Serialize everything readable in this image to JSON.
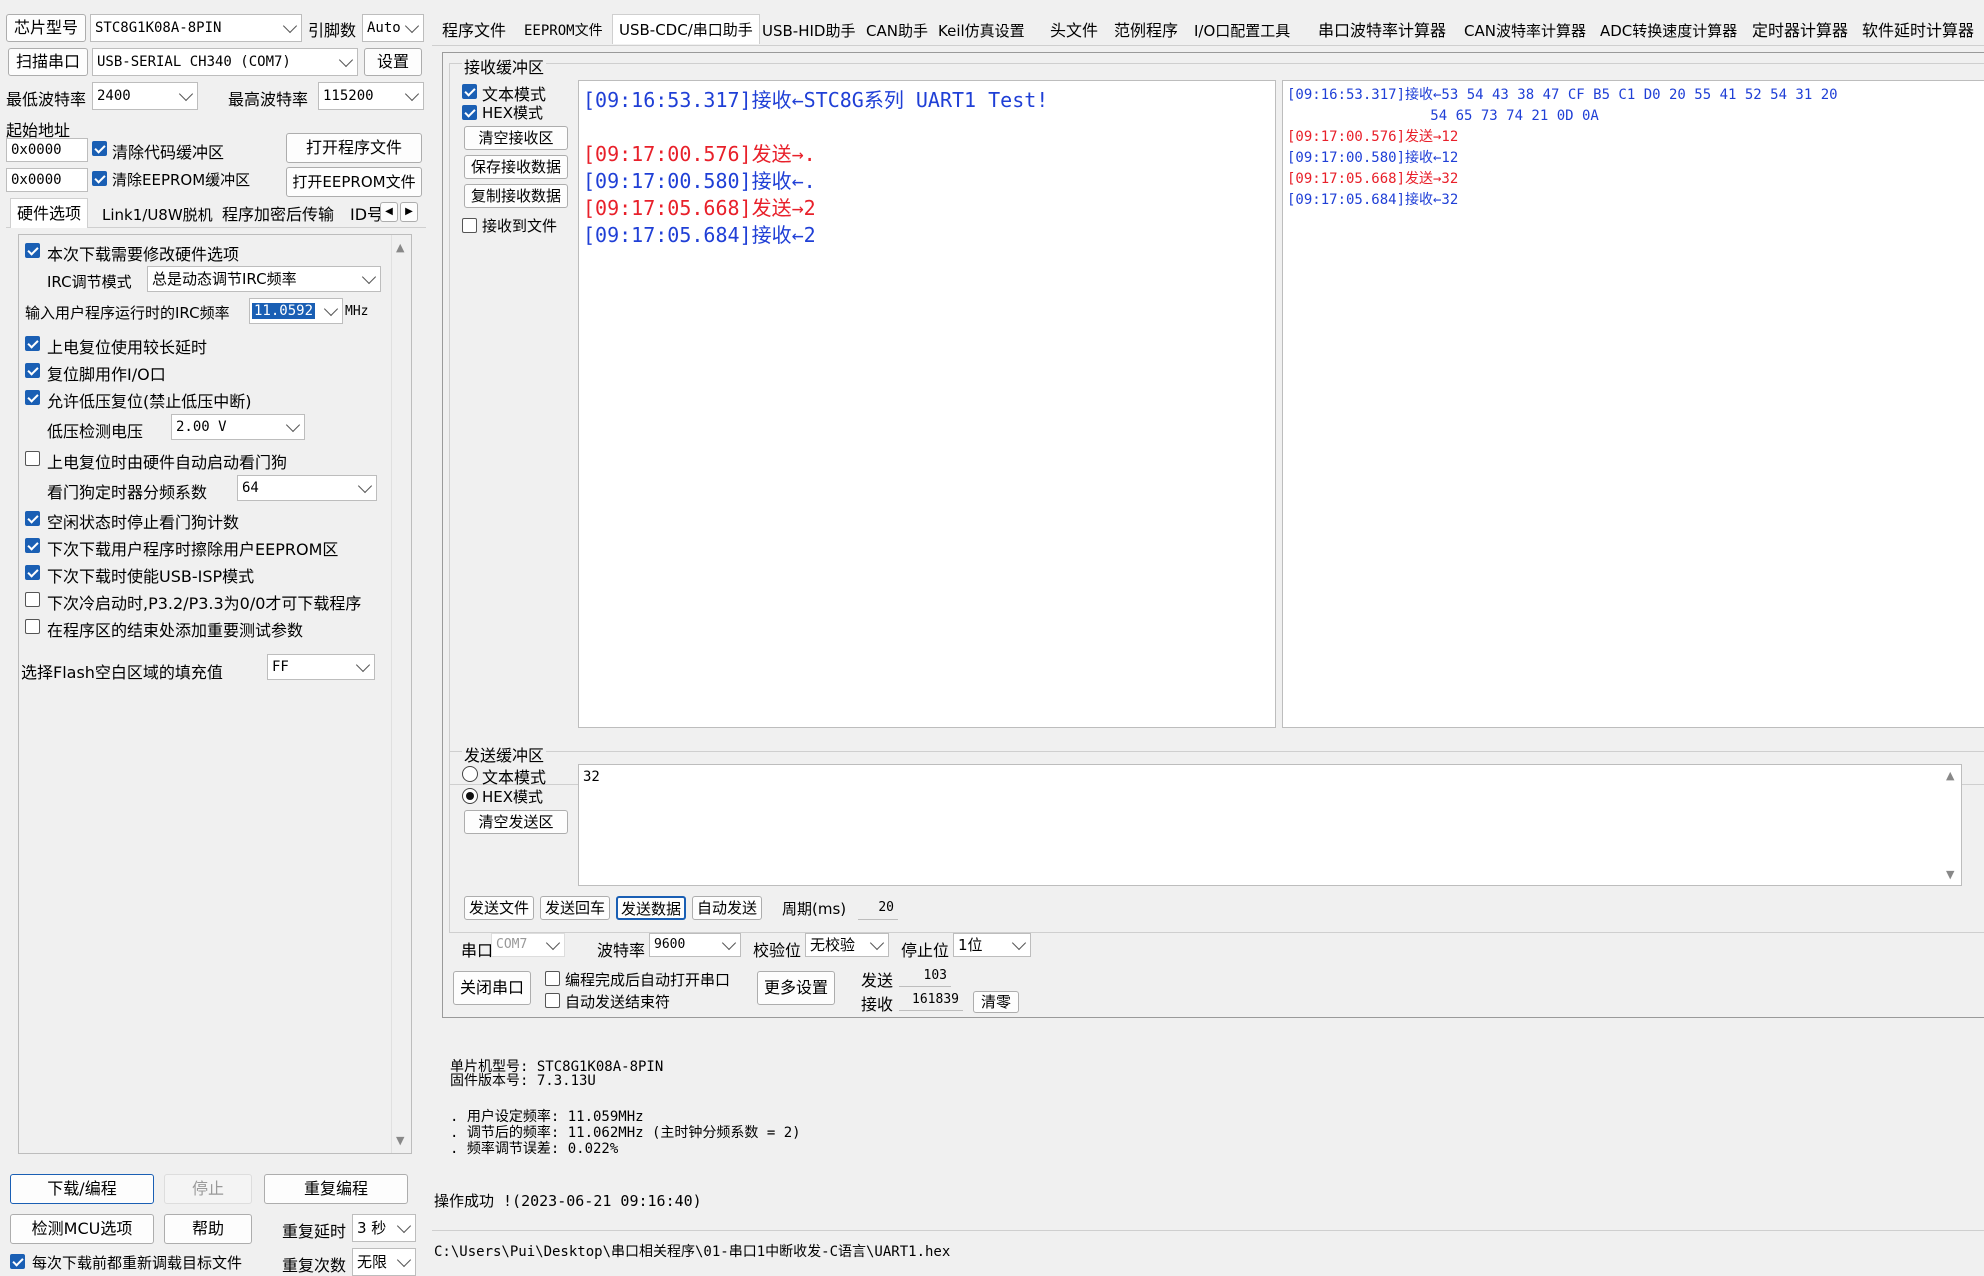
{
  "left": {
    "chip_label": "芯片型号",
    "chip_value": "STC8G1K08A-8PIN",
    "pins_label": "引脚数",
    "pins_value": "Auto",
    "scan_button": "扫描串口",
    "port_value": "USB-SERIAL CH340 (COM7)",
    "settings_button": "设置",
    "min_baud_label": "最低波特率",
    "min_baud_value": "2400",
    "max_baud_label": "最高波特率",
    "max_baud_value": "115200",
    "start_addr_label": "起始地址",
    "addr1": "0x0000",
    "clear_code_label": "清除代码缓冲区",
    "open_program_button": "打开程序文件",
    "addr2": "0x0000",
    "clear_eeprom_label": "清除EEPROM缓冲区",
    "open_eeprom_button": "打开EEPROM文件",
    "tabs": [
      "硬件选项",
      "Link1/U8W脱机",
      "程序加密后传输",
      "ID号"
    ],
    "options": {
      "modify_hw": "本次下载需要修改硬件选项",
      "irc_mode_label": "IRC调节模式",
      "irc_mode_value": "总是动态调节IRC频率",
      "irc_freq_label": "输入用户程序运行时的IRC频率",
      "irc_freq_value": "11.0592",
      "irc_freq_unit": "MHz",
      "long_delay": "上电复位使用较长延时",
      "reset_io": "复位脚用作I/O口",
      "low_volt_reset": "允许低压复位(禁止低压中断)",
      "low_volt_label": "低压检测电压",
      "low_volt_value": "2.00 V",
      "watchdog_auto": "上电复位时由硬件自动启动看门狗",
      "wdt_div_label": "看门狗定时器分频系数",
      "wdt_div_value": "64",
      "idle_stop_wdt": "空闲状态时停止看门狗计数",
      "erase_eeprom": "下次下载用户程序时擦除用户EEPROM区",
      "usb_isp": "下次下载时使能USB-ISP模式",
      "cold_boot": "下次冷启动时,P3.2/P3.3为0/0才可下载程序",
      "add_test_params": "在程序区的结束处添加重要测试参数",
      "flash_fill_label": "选择Flash空白区域的填充值",
      "flash_fill_value": "FF"
    },
    "download_button": "下载/编程",
    "stop_button": "停止",
    "reprogram_button": "重复编程",
    "check_mcu_button": "检测MCU选项",
    "help_button": "帮助",
    "repeat_delay_label": "重复延时",
    "repeat_delay_value": "3 秒",
    "repeat_count_label": "重复次数",
    "repeat_count_value": "无限",
    "reload_label": "每次下载前都重新调载目标文件"
  },
  "top_tabs": [
    "程序文件",
    "EEPROM文件",
    "USB-CDC/串口助手",
    "USB-HID助手",
    "CAN助手",
    "Keil仿真设置",
    "头文件",
    "范例程序",
    "I/O口配置工具",
    "串口波特率计算器",
    "CAN波特率计算器",
    "ADC转换速度计算器",
    "定时器计算器",
    "软件延时计算器"
  ],
  "receive": {
    "title": "接收缓冲区",
    "text_mode": "文本模式",
    "hex_mode": "HEX模式",
    "clear_button": "清空接收区",
    "save_button": "保存接收数据",
    "copy_button": "复制接收数据",
    "to_file_label": "接收到文件",
    "text_lines": [
      {
        "text": "[09:16:53.317]接收←STC8G系列 UART1 Test!",
        "color": "#1f3fd6"
      },
      {
        "text": "",
        "color": "#1f3fd6"
      },
      {
        "text": "[09:17:00.576]发送→.",
        "color": "#e8202a"
      },
      {
        "text": "[09:17:00.580]接收←.",
        "color": "#1f3fd6"
      },
      {
        "text": "[09:17:05.668]发送→2",
        "color": "#e8202a"
      },
      {
        "text": "[09:17:05.684]接收←2",
        "color": "#1f3fd6"
      }
    ],
    "hex_lines": [
      {
        "text": "[09:16:53.317]接收←53 54 43 38 47 CF B5 C1 D0 20 55 41 52 54 31 20",
        "color": "#1f3fd6"
      },
      {
        "text": "                 54 65 73 74 21 0D 0A",
        "color": "#1f3fd6"
      },
      {
        "text": "[09:17:00.576]发送→12",
        "color": "#e8202a"
      },
      {
        "text": "[09:17:00.580]接收←12",
        "color": "#1f3fd6"
      },
      {
        "text": "[09:17:05.668]发送→32",
        "color": "#e8202a"
      },
      {
        "text": "[09:17:05.684]接收←32",
        "color": "#1f3fd6"
      }
    ]
  },
  "send": {
    "title": "发送缓冲区",
    "text_mode": "文本模式",
    "hex_mode": "HEX模式",
    "clear_button": "清空发送区",
    "content": "32",
    "send_file_button": "发送文件",
    "send_enter_button": "发送回车",
    "send_data_button": "发送数据",
    "auto_send_button": "自动发送",
    "period_label": "周期(ms)",
    "period_value": "20"
  },
  "serial": {
    "port_label": "串口",
    "port_value": "COM7",
    "baud_label": "波特率",
    "baud_value": "9600",
    "parity_label": "校验位",
    "parity_value": "无校验",
    "stop_label": "停止位",
    "stop_value": "1位",
    "close_button": "关闭串口",
    "auto_open_label": "编程完成后自动打开串口",
    "auto_end_label": "自动发送结束符",
    "more_button": "更多设置",
    "sent_label": "发送",
    "sent_value": "103",
    "recv_label": "接收",
    "recv_value": "161839",
    "clear_button": "清零"
  },
  "info": {
    "line1": "单片机型号: STC8G1K08A-8PIN",
    "line2": "固件版本号: 7.3.13U",
    "line3": ". 用户设定频率: 11.059MHz",
    "line4": ". 调节后的频率: 11.062MHz (主时钟分频系数 = 2)",
    "line5": ". 频率调节误差: 0.022%",
    "status": "操作成功 !(2023-06-21 09:16:40)",
    "path": "C:\\Users\\Pui\\Desktop\\串口相关程序\\01-串口1中断收发-C语言\\UART1.hex"
  },
  "colors": {
    "send": "#e8202a",
    "receive": "#1f3fd6",
    "accent": "#1a5fb4"
  }
}
